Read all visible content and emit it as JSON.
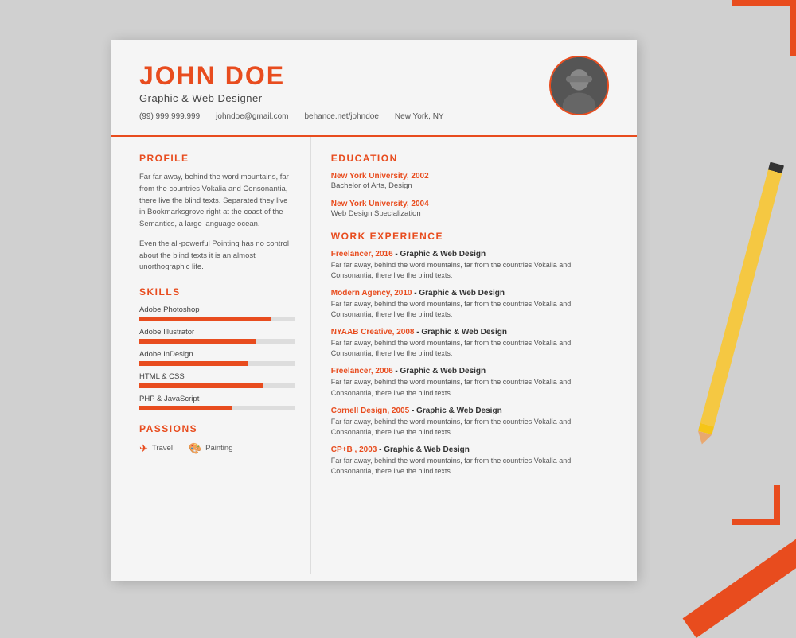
{
  "background": {
    "color": "#d0d0d0"
  },
  "accent_color": "#e84c1e",
  "header": {
    "name": "JOHN DOE",
    "title": "Graphic & Web Designer",
    "phone": "(99) 999.999.999",
    "email": "johndoe@gmail.com",
    "portfolio": "behance.net/johndoe",
    "location": "New York, NY"
  },
  "profile": {
    "section_title": "PROFILE",
    "paragraph1": "Far far away, behind the word mountains, far from the countries Vokalia and Consonantia, there live the blind texts. Separated they live in Bookmarksgrove right at the coast of the Semantics, a large language ocean.",
    "paragraph2": "Even the all-powerful Pointing has no control about the blind texts it is an almost unorthographic life."
  },
  "skills": {
    "section_title": "SKILLS",
    "items": [
      {
        "name": "Adobe Photoshop",
        "percent": 85
      },
      {
        "name": "Adobe Illustrator",
        "percent": 75
      },
      {
        "name": "Adobe InDesign",
        "percent": 70
      },
      {
        "name": "HTML & CSS",
        "percent": 80
      },
      {
        "name": "PHP & JavaScript",
        "percent": 60
      }
    ]
  },
  "passions": {
    "section_title": "PASSIONS",
    "items": [
      {
        "icon": "✈",
        "label": "Travel"
      },
      {
        "icon": "🎨",
        "label": "Painting"
      }
    ]
  },
  "education": {
    "section_title": "EDUCATION",
    "items": [
      {
        "school": "New York University, 2002",
        "degree": "Bachelor of Arts, Design"
      },
      {
        "school": "New York University, 2004",
        "degree": "Web Design Specialization"
      }
    ]
  },
  "work_experience": {
    "section_title": "WORK EXPERIENCE",
    "items": [
      {
        "company": "Freelancer, 2016",
        "role": "Graphic & Web Design",
        "description": "Far far away, behind the word mountains, far from the countries Vokalia and Consonantia, there live the blind texts."
      },
      {
        "company": "Modern Agency, 2010",
        "role": "Graphic & Web Design",
        "description": "Far far away, behind the word mountains, far from the countries Vokalia and Consonantia, there live the blind texts."
      },
      {
        "company": "NYAAB Creative, 2008",
        "role": "Graphic & Web Design",
        "description": "Far far away, behind the word mountains, far from the countries Vokalia and Consonantia, there live the blind texts."
      },
      {
        "company": "Freelancer, 2006",
        "role": "Graphic & Web Design",
        "description": "Far far away, behind the word mountains, far from the countries Vokalia and Consonantia, there live the blind texts."
      },
      {
        "company": "Cornell Design, 2005",
        "role": "Graphic & Web Design",
        "description": "Far far away, behind the word mountains, far from the countries Vokalia and Consonantia, there live the blind texts."
      },
      {
        "company": "CP+B , 2003",
        "role": "Graphic & Web Design",
        "description": "Far far away, behind the word mountains, far from the countries Vokalia and Consonantia, there live the blind texts."
      }
    ]
  }
}
